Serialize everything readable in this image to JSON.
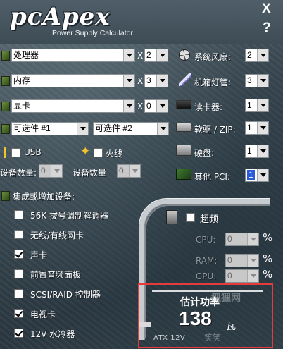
{
  "header": {
    "logo": "pcApex",
    "subtitle": "Power Supply Calculator",
    "close": "X",
    "help": "?"
  },
  "rows": {
    "cpu": {
      "label": "处理器",
      "qty": "2"
    },
    "ram": {
      "label": "内存",
      "qty": "3"
    },
    "gpu": {
      "label": "显卡",
      "qty": "0"
    },
    "opt1": {
      "label": "可选件 #1"
    },
    "opt2": {
      "label": "可选件 #2"
    }
  },
  "x_sign": "X",
  "usb": {
    "label": "USB",
    "count_label": "设备数量:",
    "count": "0"
  },
  "firewire": {
    "label": "火线",
    "count_label": "设备数量",
    "count": "0"
  },
  "right": {
    "fans": {
      "label": "系统风扇:",
      "value": "2"
    },
    "tubes": {
      "label": "机箱灯管:",
      "value": "3"
    },
    "cardreader": {
      "label": "读卡器:",
      "value": "1"
    },
    "floppy": {
      "label": "软驱 / ZIP:",
      "value": "1"
    },
    "hdd": {
      "label": "硬盘:",
      "value": "1"
    },
    "pci": {
      "label": "其他 PCI:",
      "value": "1"
    }
  },
  "integrated": {
    "title": "集成或增加设备:",
    "items": [
      {
        "label": "56K 拔号调制解调器",
        "checked": false
      },
      {
        "label": "无线/有线网卡",
        "checked": false
      },
      {
        "label": "声卡",
        "checked": true
      },
      {
        "label": "前置音频面板",
        "checked": false
      },
      {
        "label": "SCSI/RAID 控制器",
        "checked": false
      },
      {
        "label": "电视卡",
        "checked": true
      },
      {
        "label": "12V 水冷器",
        "checked": true
      }
    ]
  },
  "overclock": {
    "label": "超频",
    "cpu": "CPU:",
    "ram": "RAM:",
    "gpu": "GPU:",
    "pct": "%",
    "value": "0"
  },
  "result": {
    "label": "估计功率",
    "value": "138",
    "unit": "瓦",
    "connector": "ATX 12V",
    "watermark": "狐狸网",
    "watermark2": "笑笑"
  }
}
